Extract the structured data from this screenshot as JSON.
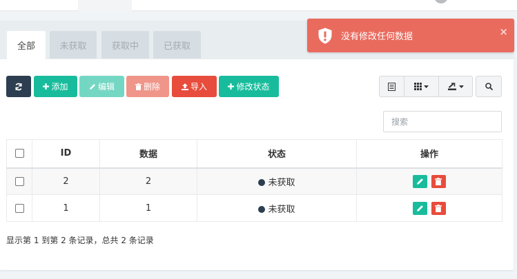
{
  "tabs": [
    {
      "label": "全部",
      "active": true
    },
    {
      "label": "未获取",
      "active": false
    },
    {
      "label": "获取中",
      "active": false
    },
    {
      "label": "已获取",
      "active": false
    }
  ],
  "toolbar": {
    "refresh_icon": "refresh-icon",
    "add_label": "添加",
    "edit_label": "编辑",
    "delete_label": "删除",
    "import_label": "导入",
    "change_status_label": "修改状态",
    "colors": {
      "primary": "#18bc9c",
      "dark": "#2c3e50",
      "danger": "#e74c3c"
    }
  },
  "search": {
    "placeholder": "搜索",
    "value": ""
  },
  "table": {
    "columns": [
      "ID",
      "数据",
      "状态",
      "操作"
    ],
    "rows": [
      {
        "id": "2",
        "data": "2",
        "status": "未获取"
      },
      {
        "id": "1",
        "data": "1",
        "status": "未获取"
      }
    ]
  },
  "summary": "显示第 1 到第 2 条记录，总共 2 条记录",
  "toast": {
    "message": "没有修改任何数据",
    "close": "×",
    "color": "#e96b5e"
  }
}
